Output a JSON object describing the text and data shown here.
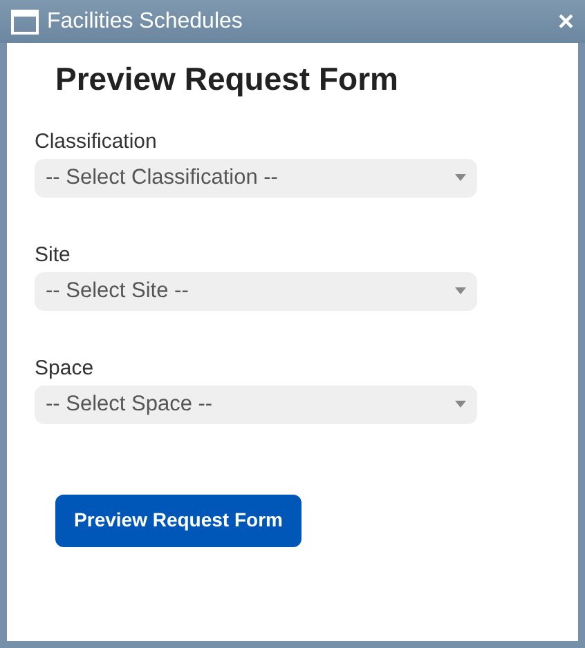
{
  "window": {
    "title": "Facilities Schedules",
    "close": "×"
  },
  "heading": "Preview Request Form",
  "fields": [
    {
      "label": "Classification",
      "placeholder": "-- Select Classification --"
    },
    {
      "label": "Site",
      "placeholder": "-- Select Site --"
    },
    {
      "label": "Space",
      "placeholder": "-- Select Space --"
    }
  ],
  "button": "Preview Request Form"
}
